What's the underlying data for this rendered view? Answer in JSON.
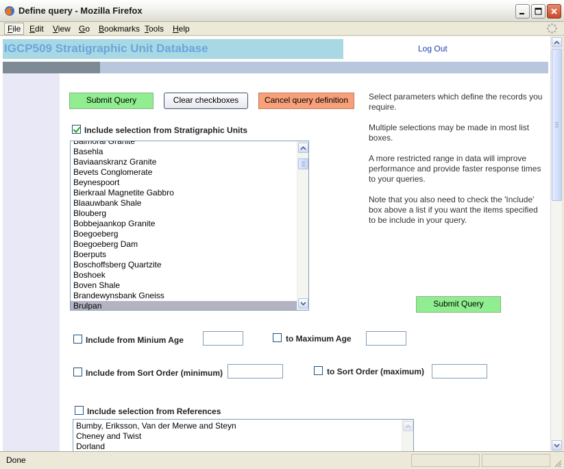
{
  "window": {
    "title": "Define query - Mozilla Firefox"
  },
  "menubar": {
    "items": [
      {
        "ul": "F",
        "rest": "ile"
      },
      {
        "ul": "E",
        "rest": "dit"
      },
      {
        "ul": "V",
        "rest": "iew"
      },
      {
        "ul": "G",
        "rest": "o"
      },
      {
        "ul": "B",
        "rest": "ookmarks"
      },
      {
        "ul": "T",
        "rest": "ools"
      },
      {
        "ul": "H",
        "rest": "elp"
      }
    ]
  },
  "page": {
    "site_title": "IGCP509 Stratigraphic Unit Database",
    "logout": "Log Out",
    "buttons": {
      "submit": "Submit Query",
      "clear": "Clear checkboxes",
      "cancel": "Cancel query definition",
      "submit2": "Submit Query"
    },
    "help": [
      "Select parameters which define the records you require.",
      "Multiple selections may be made in most list boxes.",
      "A more restricted range in data will improve performance and provide faster response times to your queries.",
      "Note that you also need to check the 'Include' box above a list if you want the items specified to be include in your query."
    ],
    "strat_units": {
      "label": "Include selection from Stratigraphic Units",
      "checked": true,
      "items": [
        "Balmoral Granite",
        "Basehla",
        "Baviaanskranz Granite",
        "Bevets Conglomerate",
        "Beynespoort",
        "Bierkraal Magnetite Gabbro",
        "Blaauwbank Shale",
        "Blouberg",
        "Bobbejaankop Granite",
        "Boegoeberg",
        "Boegoeberg Dam",
        "Boerputs",
        "Boschoffsberg Quartzite",
        "Boshoek",
        "Boven Shale",
        "Brandewynsbank Gneiss",
        "Brulpan"
      ],
      "selected": "Brulpan"
    },
    "min_age": {
      "label": "Include from Minium Age",
      "value": ""
    },
    "max_age": {
      "label": "to Maximum Age",
      "value": ""
    },
    "sort_min": {
      "label": "Include from Sort Order (minimum)",
      "value": ""
    },
    "sort_max": {
      "label": "to Sort Order (maximum)",
      "value": ""
    },
    "references": {
      "label": "Include selection from References",
      "checked": false,
      "items": [
        "Bumby, Eriksson, Van der Merwe and Steyn",
        "Cheney and Twist",
        "Dorland"
      ]
    }
  },
  "status": {
    "text": "Done"
  },
  "colors": {
    "header_band": "#a9d8e5",
    "title_text": "#6aa6dc",
    "nav_bar": "#b8c7dd",
    "nav_dark": "#7e8a96",
    "left_col": "#e8e8f6",
    "green_button": "#90ee90",
    "orange_button": "#f8a07a",
    "selected_row": "#b3b3c2"
  }
}
